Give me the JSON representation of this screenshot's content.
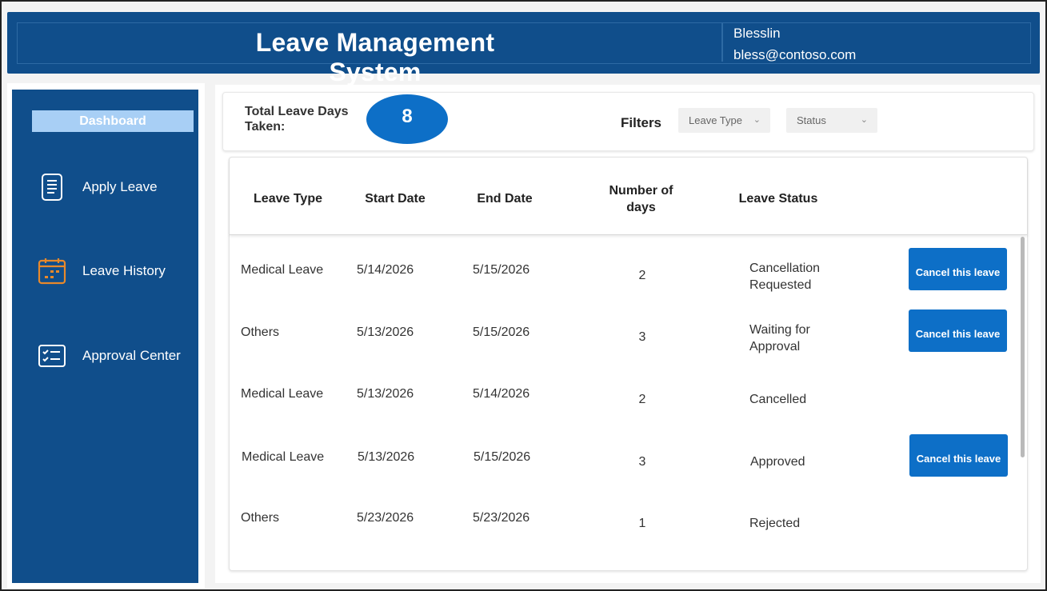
{
  "header": {
    "title": "Leave Management System",
    "user_name": "Blesslin",
    "user_email": "bless@contoso.com"
  },
  "sidebar": {
    "dashboard_label": "Dashboard",
    "items": [
      {
        "label": "Apply Leave",
        "icon": "document-icon"
      },
      {
        "label": "Leave History",
        "icon": "calendar-icon"
      },
      {
        "label": "Approval Center",
        "icon": "checklist-icon"
      }
    ]
  },
  "summary": {
    "total_label": "Total Leave Days Taken:",
    "total_value": "8",
    "filters_label": "Filters",
    "leave_type_dropdown": "Leave Type",
    "status_dropdown": "Status"
  },
  "table": {
    "columns": [
      "Leave Type",
      "Start Date",
      "End Date",
      "Number of days",
      "Leave Status"
    ],
    "rows": [
      {
        "type": "Medical Leave",
        "start": "5/14/2026",
        "end": "5/15/2026",
        "days": "2",
        "status": "Cancellation Requested",
        "action": "Cancel this leave"
      },
      {
        "type": "Others",
        "start": "5/13/2026",
        "end": "5/15/2026",
        "days": "3",
        "status": "Waiting for Approval",
        "action": "Cancel this leave"
      },
      {
        "type": "Medical Leave",
        "start": "5/13/2026",
        "end": "5/14/2026",
        "days": "2",
        "status": "Cancelled",
        "action": ""
      },
      {
        "type": "Medical Leave",
        "start": "5/13/2026",
        "end": "5/15/2026",
        "days": "3",
        "status": "Approved",
        "action": "Cancel this leave"
      },
      {
        "type": "Others",
        "start": "5/23/2026",
        "end": "5/23/2026",
        "days": "1",
        "status": "Rejected",
        "action": ""
      }
    ]
  },
  "colors": {
    "brand_blue": "#104e8b",
    "accent_blue": "#0d6fc7",
    "icon_orange": "#e8892b"
  }
}
